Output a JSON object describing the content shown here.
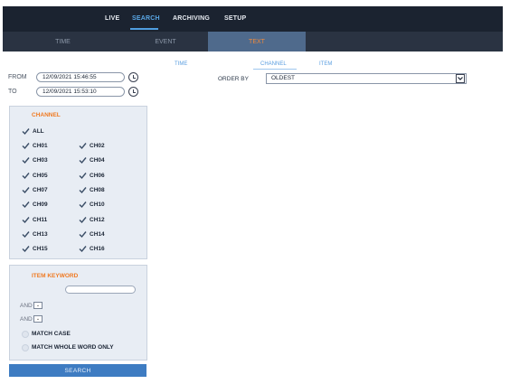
{
  "nav": {
    "items": [
      "LIVE",
      "SEARCH",
      "ARCHIVING",
      "SETUP"
    ],
    "active": "SEARCH"
  },
  "tabs": [
    "TIME",
    "EVENT",
    "TEXT"
  ],
  "active_tab": "TEXT",
  "time_range": {
    "from_label": "FROM",
    "from_value": "12/09/2021 15:46:55",
    "to_label": "TO",
    "to_value": "12/09/2021 15:53:10"
  },
  "channel": {
    "title": "CHANNEL",
    "all_label": "ALL",
    "channels": [
      "CH01",
      "CH02",
      "CH03",
      "CH04",
      "CH05",
      "CH06",
      "CH07",
      "CH08",
      "CH09",
      "CH10",
      "CH11",
      "CH12",
      "CH13",
      "CH14",
      "CH15",
      "CH16"
    ]
  },
  "keyword": {
    "title": "ITEM KEYWORD",
    "and_label_1": "AND",
    "and_label_2": "AND",
    "match_case": "MATCH CASE",
    "match_whole": "MATCH WHOLE WORD ONLY"
  },
  "search_button": "SEARCH",
  "subtabs": [
    "TIME",
    "CHANNEL",
    "ITEM"
  ],
  "order_by": {
    "label": "ORDER BY",
    "value": "OLDEST"
  },
  "colors": {
    "accent_orange": "#f07a22",
    "accent_blue": "#4f9de0",
    "nav_bg": "#1b2330"
  }
}
